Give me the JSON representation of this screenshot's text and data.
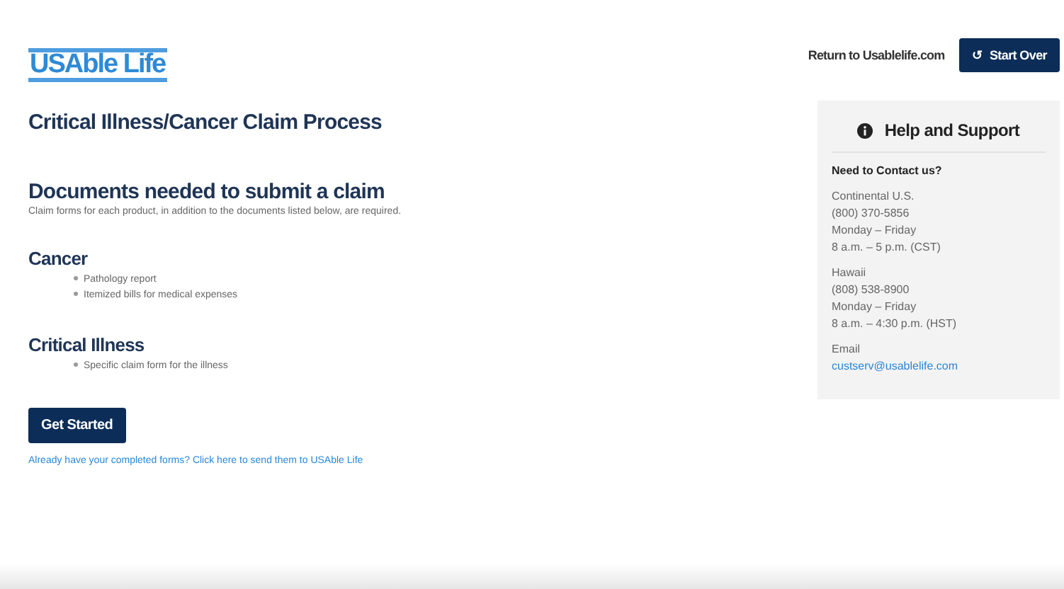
{
  "header": {
    "logo": "USAble Life",
    "return_link": "Return to Usablelife.com",
    "start_over": {
      "icon": "↺",
      "label": "Start Over"
    }
  },
  "title": "Critical Illness/Cancer Claim Process",
  "documents": {
    "heading": "Documents needed to submit a claim",
    "intro": "Claim forms for each product, in addition to the documents listed below, are required.",
    "sections": [
      {
        "heading": "Cancer",
        "items": [
          "Pathology report",
          "Itemized bills for medical expenses"
        ]
      },
      {
        "heading": "Critical Illness",
        "items": [
          "Specific claim form for the illness"
        ]
      }
    ]
  },
  "get_started": "Get Started",
  "send_link": "Already have your completed forms? Click here to send them to USAble Life",
  "help": {
    "title": "Help and Support",
    "question": "Need to Contact us?",
    "contacts": [
      {
        "lines": [
          "Continental U.S.",
          "(800) 370-5856",
          "Monday – Friday",
          "8 a.m. – 5 p.m. (CST)"
        ]
      },
      {
        "lines": [
          "Hawaii",
          "(808) 538-8900",
          "Monday – Friday",
          "8 a.m. – 4:30 p.m. (HST)"
        ]
      }
    ],
    "email_label": "Email",
    "email": "custserv@usablelife.com"
  }
}
